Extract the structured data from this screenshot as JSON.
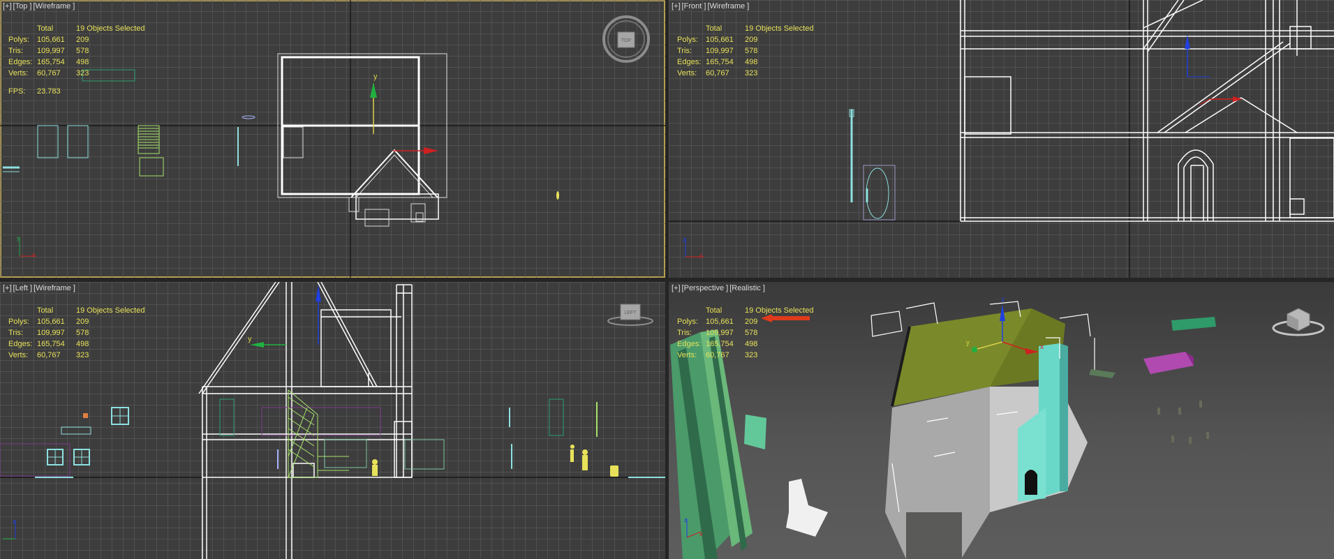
{
  "stats": {
    "total_header": "Total",
    "selected_header": "19 Objects Selected",
    "rows": [
      {
        "label": "Polys:",
        "total": "105,661",
        "selected": "209"
      },
      {
        "label": "Tris:",
        "total": "109,997",
        "selected": "578"
      },
      {
        "label": "Edges:",
        "total": "165,754",
        "selected": "498"
      },
      {
        "label": "Verts:",
        "total": "60,767",
        "selected": "323"
      }
    ],
    "fps_label": "FPS:",
    "fps_value": "23.783"
  },
  "viewports": {
    "top": {
      "plus": "[+]",
      "view": "[Top ]",
      "shading": "[Wireframe ]",
      "cube_label": "TOP"
    },
    "front": {
      "plus": "[+]",
      "view": "[Front ]",
      "shading": "[Wireframe ]"
    },
    "left": {
      "plus": "[+]",
      "view": "[Left ]",
      "shading": "[Wireframe ]",
      "cube_label": "LEFT"
    },
    "perspective": {
      "plus": "[+]",
      "view": "[Perspective ]",
      "shading": "[Realistic ]"
    }
  },
  "axes": {
    "x": "x",
    "y": "y",
    "z": "z"
  },
  "colors": {
    "stats_text": "#e8e25a",
    "grid_bg": "#3d3d3d",
    "active_border": "#b8a050",
    "wire_white": "#ffffff",
    "wire_cyan": "#8ee0e0",
    "wire_green": "#a6e26a",
    "axis_red": "#d02020",
    "axis_green": "#20b040",
    "axis_blue": "#2040e0",
    "roof_olive": "#7a8a2a",
    "chimney_teal": "#6ad8c8"
  }
}
